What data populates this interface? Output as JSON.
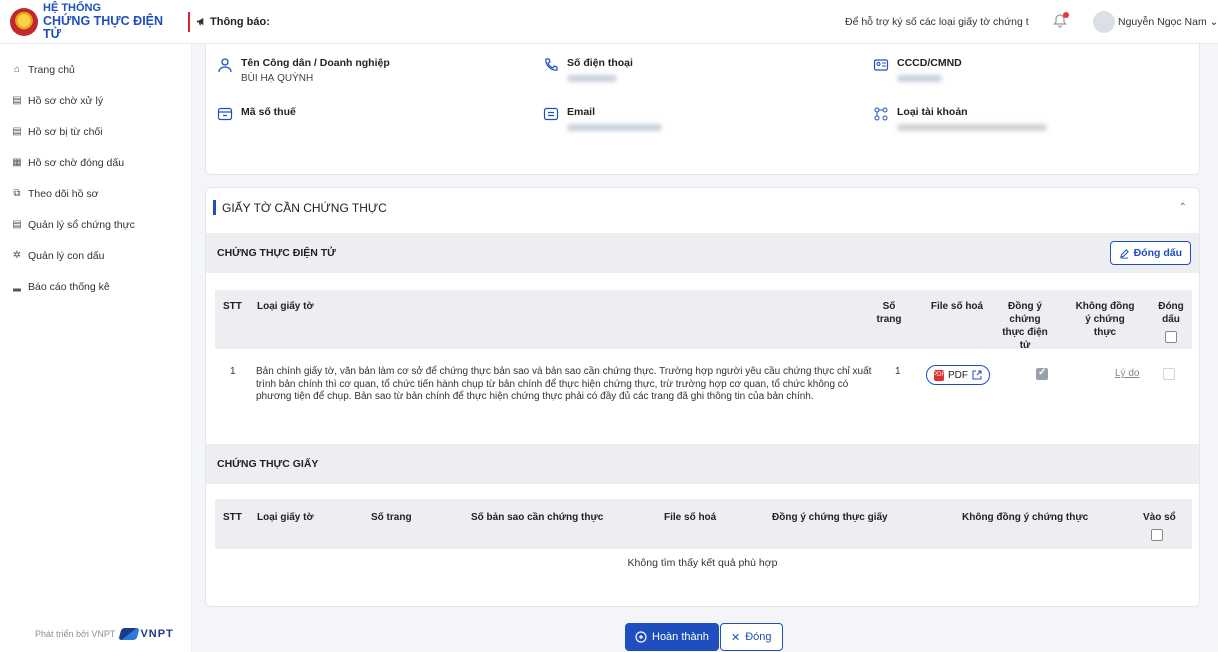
{
  "header": {
    "app_title_line1": "HỆ THỐNG",
    "app_title_line2": "CHỨNG THỰC ĐIỆN TỬ",
    "notice_label": "Thông báo:",
    "marquee_text": "Để hỗ trợ ký số các loại giấy tờ chứng t",
    "user_name": "Nguyễn Ngọc Nam"
  },
  "sidebar": {
    "items": [
      {
        "label": "Trang chủ",
        "icon": "home-icon"
      },
      {
        "label": "Hồ sơ chờ xử lý",
        "icon": "document-icon"
      },
      {
        "label": "Hồ sơ bị từ chối",
        "icon": "document-icon"
      },
      {
        "label": "Hồ sơ chờ đóng dấu",
        "icon": "grid-icon"
      },
      {
        "label": "Theo dõi hồ sơ",
        "icon": "track-icon"
      },
      {
        "label": "Quản lý sổ chứng thực",
        "icon": "book-icon"
      },
      {
        "label": "Quản lý con dấu",
        "icon": "gear-icon"
      },
      {
        "label": "Báo cáo thống kê",
        "icon": "bar-chart-icon"
      }
    ],
    "footer_text": "Phát triển bởi VNPT",
    "brand": "VNPT"
  },
  "info": {
    "name_label": "Tên Công dân / Doanh nghiệp",
    "name_value": "BÙI HẠ QUỲNH",
    "phone_label": "Số điện thoại",
    "id_label": "CCCD/CMND",
    "tax_label": "Mã số thuế",
    "email_label": "Email",
    "account_type_label": "Loại tài khoản"
  },
  "docs": {
    "section_title": "GIẤY TỜ CẦN CHỨNG THỰC",
    "electronic": {
      "title": "CHỨNG THỰC ĐIỆN TỬ",
      "stamp_button": "Đóng dấu",
      "columns": {
        "stt": "STT",
        "type": "Loại giấy tờ",
        "pages": "Số trang",
        "file": "File số hoá",
        "agree": "Đồng ý chứng thực điện tử",
        "disagree": "Không đồng ý chứng thực",
        "stamp": "Đóng dấu"
      },
      "rows": [
        {
          "stt": "1",
          "type": "Bản chính giấy tờ, văn bản làm cơ sở để chứng thực bản sao và bản sao cần chứng thực. Trường hợp người yêu cầu chứng thực chỉ xuất trình bản chính thì cơ quan, tổ chức tiến hành chụp từ bản chính để thực hiện chứng thực, trừ trường hợp cơ quan, tổ chức không có phương tiện để chụp. Bản sao từ bản chính để thực hiện chứng thực phải có đầy đủ các trang đã ghi thông tin của bản chính.",
          "pages": "1",
          "file_label": "PDF",
          "reason_link": "Lý do"
        }
      ]
    },
    "paper": {
      "title": "CHỨNG THỰC GIẤY",
      "columns": {
        "stt": "STT",
        "type": "Loại giấy tờ",
        "pages": "Số trang",
        "copies": "Số bản sao cần chứng thực",
        "file": "File số hoá",
        "agree": "Đồng ý chứng thực giấy",
        "disagree": "Không đồng ý chứng thực",
        "register": "Vào sổ"
      },
      "empty_text": "Không tìm thấy kết quả phù hợp"
    }
  },
  "actions": {
    "complete": "Hoàn thành",
    "close": "Đóng"
  },
  "colors": {
    "primary": "#1f4fbf",
    "accent_red": "#d9262c"
  }
}
